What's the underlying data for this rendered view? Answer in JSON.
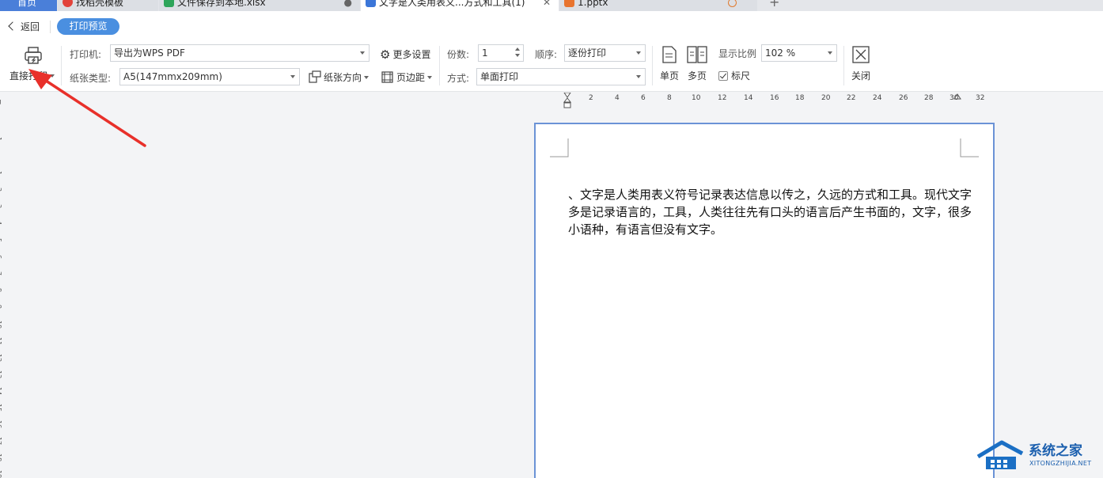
{
  "tabs": [
    {
      "label": "首页",
      "name": "tab-home"
    },
    {
      "label": "找稻壳模板",
      "name": "tab-templates"
    },
    {
      "label": "文件保存到本地.xlsx",
      "name": "tab-xlsx"
    },
    {
      "label": "文字是人类用表义...方式和工具(1)",
      "name": "tab-doc-active"
    },
    {
      "label": "1.pptx",
      "name": "tab-pptx"
    }
  ],
  "header": {
    "back_label": "返回",
    "mode_label": "打印预览"
  },
  "toolbar": {
    "direct_print_label": "直接打印",
    "printer_label": "打印机:",
    "printer_value": "导出为WPS PDF",
    "paper_type_label": "纸张类型:",
    "paper_type_value": "A5(147mmx209mm)",
    "more_settings_label": "更多设置",
    "paper_orientation_label": "纸张方向",
    "margins_label": "页边距",
    "copies_label": "份数:",
    "copies_value": "1",
    "order_label": "顺序:",
    "order_value": "逐份打印",
    "method_label": "方式:",
    "method_value": "单面打印",
    "single_page_label": "单页",
    "multi_page_label": "多页",
    "zoom_label": "显示比例",
    "zoom_value": "102 %",
    "ruler_label": "标尺",
    "ruler_checked": true,
    "close_label": "关闭"
  },
  "h_ruler_labels": [
    "2",
    "4",
    "6",
    "8",
    "10",
    "12",
    "14",
    "16",
    "18",
    "20",
    "22",
    "24",
    "26",
    "28",
    "30",
    "32"
  ],
  "v_ruler_labels": [
    "1",
    "1",
    "2",
    "3",
    "4",
    "5",
    "6",
    "7",
    "8",
    "9",
    "10",
    "11",
    "12",
    "13",
    "14",
    "15",
    "16",
    "17",
    "18",
    "19"
  ],
  "document": {
    "text": "、文字是人类用表义符号记录表达信息以传之，久远的方式和工具。现代文字多是记录语言的，工具，人类往往先有口头的语言后产生书面的，文字，很多小语种，有语言但没有文字。"
  },
  "watermark": {
    "brand": "系统之家",
    "url": "XITONGZHIJIA.NET"
  },
  "colors": {
    "accent": "#4a8fe0",
    "tab_home": "#4a7fd9",
    "page_border": "#6b93d6",
    "arrow": "#e8302a"
  }
}
